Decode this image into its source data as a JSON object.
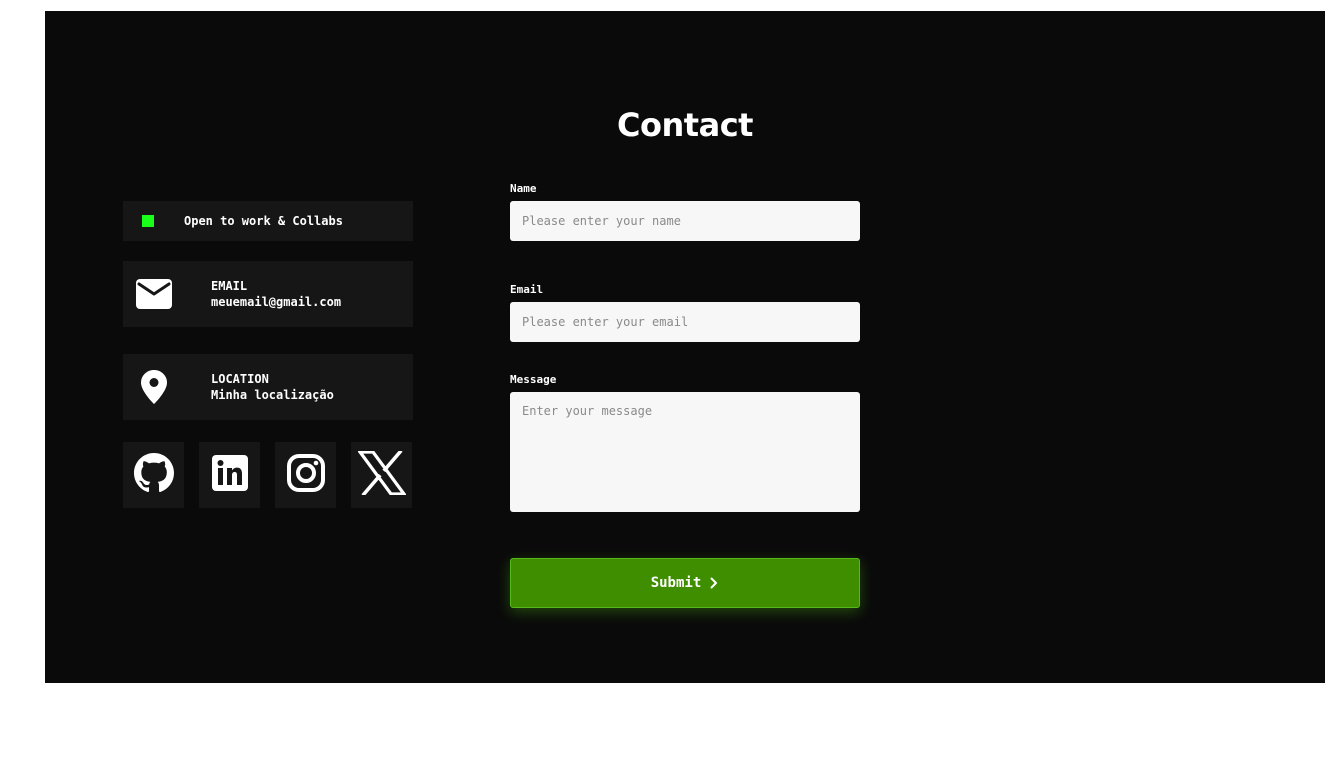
{
  "page": {
    "title": "Contact"
  },
  "status": {
    "text": "Open to work & Collabs",
    "indicator_color": "#19ff19"
  },
  "contact_info": {
    "email": {
      "label": "EMAIL",
      "value": "meuemail@gmail.com",
      "icon": "envelope-icon"
    },
    "location": {
      "label": "LOCATION",
      "value": "Minha localização",
      "icon": "map-pin-icon"
    }
  },
  "socials": [
    {
      "icon": "github-icon"
    },
    {
      "icon": "linkedin-icon"
    },
    {
      "icon": "instagram-icon"
    },
    {
      "icon": "x-twitter-icon"
    }
  ],
  "form": {
    "name": {
      "label": "Name",
      "placeholder": "Please enter your name",
      "value": ""
    },
    "email": {
      "label": "Email",
      "placeholder": "Please enter your email",
      "value": ""
    },
    "message": {
      "label": "Message",
      "placeholder": "Enter your message",
      "value": ""
    },
    "submit_label": "Submit",
    "submit_icon": "chevron-right-icon"
  },
  "colors": {
    "background": "#0a0a0a",
    "card": "#161616",
    "accent": "#3e8e00"
  }
}
